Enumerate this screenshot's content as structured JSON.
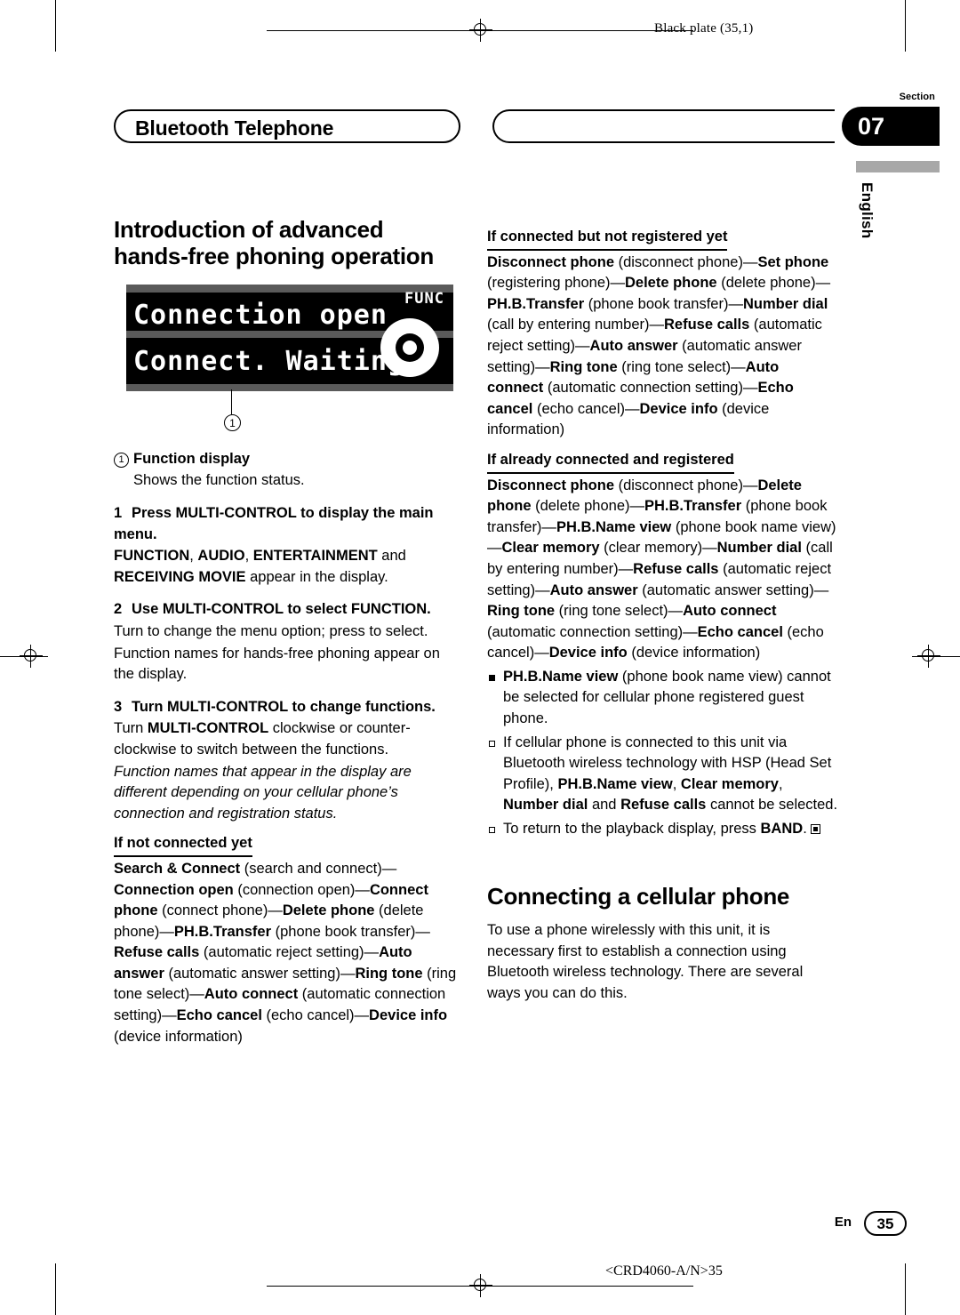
{
  "page": {
    "black_plate": "Black plate (35,1)",
    "section_label": "Section",
    "section_number": "07",
    "language_tab": "English",
    "running_head": "Bluetooth Telephone",
    "footer_en": "En",
    "footer_page": "35",
    "footer_code": "<CRD4060-A/N>35"
  },
  "lcd": {
    "line1": "Connection open",
    "line2": "Connect. Waiting",
    "fn_label": "FUNC",
    "callout": "1"
  },
  "left_column": {
    "heading": "Introduction of advanced hands-free phoning operation",
    "callout_item": {
      "num": "1",
      "title": "Function display",
      "desc": "Shows the function status."
    },
    "step1": {
      "num": "1",
      "title": "Press MULTI-CONTROL to display the main menu.",
      "body_bold_1": "FUNCTION",
      "body_sep_1": ", ",
      "body_bold_2": "AUDIO",
      "body_sep_2": ", ",
      "body_bold_3": "ENTERTAINMENT",
      "body_mid": " and ",
      "body_bold_4": "RECEIVING MOVIE",
      "body_tail": " appear in the display."
    },
    "step2": {
      "num": "2",
      "title": "Use MULTI-CONTROL to select FUNCTION.",
      "p1": "Turn to change the menu option; press to select.",
      "p2": "Function names for hands-free phoning appear on the display."
    },
    "step3": {
      "num": "3",
      "title": "Turn MULTI-CONTROL to change functions.",
      "p1_a": "Turn ",
      "p1_b": "MULTI-CONTROL",
      "p1_c": " clockwise or counter-clockwise to switch between the functions.",
      "p2": "Function names that appear in the display are different depending on your cellular phone’s connection and registration status."
    },
    "not_connected_heading": "If not connected yet",
    "not_connected_chain": [
      {
        "t": "Search & Connect",
        "s": "b"
      },
      {
        "t": " (search and connect)—",
        "s": "n"
      },
      {
        "t": "Connection open",
        "s": "b"
      },
      {
        "t": " (connection open)—",
        "s": "n"
      },
      {
        "t": "Connect phone",
        "s": "b"
      },
      {
        "t": " (connect phone)—",
        "s": "n"
      },
      {
        "t": "Delete phone",
        "s": "b"
      },
      {
        "t": " (delete phone)—",
        "s": "n"
      },
      {
        "t": "PH.B.Transfer",
        "s": "b"
      },
      {
        "t": " (phone book transfer)—",
        "s": "n"
      },
      {
        "t": "Refuse calls",
        "s": "b"
      },
      {
        "t": " (automatic reject setting)—",
        "s": "n"
      },
      {
        "t": "Auto answer",
        "s": "b"
      },
      {
        "t": " (automatic answer setting)—",
        "s": "n"
      },
      {
        "t": "Ring tone",
        "s": "b"
      },
      {
        "t": " (ring tone select)—",
        "s": "n"
      },
      {
        "t": "Auto connect",
        "s": "b"
      },
      {
        "t": " (automatic connection setting)—",
        "s": "n"
      },
      {
        "t": "Echo cancel",
        "s": "b"
      },
      {
        "t": " (echo cancel)—",
        "s": "n"
      },
      {
        "t": "Device info",
        "s": "b"
      },
      {
        "t": " (device information)",
        "s": "n"
      }
    ]
  },
  "right_column": {
    "connected_not_registered_heading": "If connected but not registered yet",
    "connected_not_registered_chain": [
      {
        "t": "Disconnect phone",
        "s": "b"
      },
      {
        "t": " (disconnect phone)—",
        "s": "n"
      },
      {
        "t": "Set phone",
        "s": "b"
      },
      {
        "t": " (registering phone)—",
        "s": "n"
      },
      {
        "t": "Delete phone",
        "s": "b"
      },
      {
        "t": " (delete phone)—",
        "s": "n"
      },
      {
        "t": "PH.B.Transfer",
        "s": "b"
      },
      {
        "t": " (phone book transfer)—",
        "s": "n"
      },
      {
        "t": "Number dial",
        "s": "b"
      },
      {
        "t": " (call by entering number)—",
        "s": "n"
      },
      {
        "t": "Refuse calls",
        "s": "b"
      },
      {
        "t": " (automatic reject setting)—",
        "s": "n"
      },
      {
        "t": "Auto answer",
        "s": "b"
      },
      {
        "t": " (automatic answer setting)—",
        "s": "n"
      },
      {
        "t": "Ring tone",
        "s": "b"
      },
      {
        "t": " (ring tone select)—",
        "s": "n"
      },
      {
        "t": "Auto connect",
        "s": "b"
      },
      {
        "t": " (automatic connection setting)—",
        "s": "n"
      },
      {
        "t": "Echo cancel",
        "s": "b"
      },
      {
        "t": " (echo cancel)—",
        "s": "n"
      },
      {
        "t": "Device info",
        "s": "b"
      },
      {
        "t": " (device information)",
        "s": "n"
      }
    ],
    "already_connected_heading": "If already connected and registered",
    "already_connected_chain": [
      {
        "t": "Disconnect phone",
        "s": "b"
      },
      {
        "t": " (disconnect phone)—",
        "s": "n"
      },
      {
        "t": "Delete phone",
        "s": "b"
      },
      {
        "t": " (delete phone)—",
        "s": "n"
      },
      {
        "t": "PH.B.Transfer",
        "s": "b"
      },
      {
        "t": " (phone book transfer)—",
        "s": "n"
      },
      {
        "t": "PH.B.Name view",
        "s": "b"
      },
      {
        "t": " (phone book name view)—",
        "s": "n"
      },
      {
        "t": "Clear memory",
        "s": "b"
      },
      {
        "t": " (clear memory)—",
        "s": "n"
      },
      {
        "t": "Number dial",
        "s": "b"
      },
      {
        "t": " (call by entering number)—",
        "s": "n"
      },
      {
        "t": "Refuse calls",
        "s": "b"
      },
      {
        "t": " (automatic reject setting)—",
        "s": "n"
      },
      {
        "t": "Auto answer",
        "s": "b"
      },
      {
        "t": " (automatic answer setting)—",
        "s": "n"
      },
      {
        "t": "Ring tone",
        "s": "b"
      },
      {
        "t": " (ring tone select)—",
        "s": "n"
      },
      {
        "t": "Auto connect",
        "s": "b"
      },
      {
        "t": " (automatic connection setting)—",
        "s": "n"
      },
      {
        "t": "Echo cancel",
        "s": "b"
      },
      {
        "t": " (echo cancel)—",
        "s": "n"
      },
      {
        "t": "Device info",
        "s": "b"
      },
      {
        "t": " (device information)",
        "s": "n"
      }
    ],
    "note1": [
      {
        "t": "PH.B.Name view",
        "s": "b"
      },
      {
        "t": " (phone book name view) cannot be selected for cellular phone registered guest phone.",
        "s": "n"
      }
    ],
    "note2": [
      {
        "t": "If cellular phone is connected to this unit via Bluetooth wireless technology with HSP (Head Set Profile), ",
        "s": "n"
      },
      {
        "t": "PH.B.Name view",
        "s": "b"
      },
      {
        "t": ", ",
        "s": "n"
      },
      {
        "t": "Clear memory",
        "s": "b"
      },
      {
        "t": ", ",
        "s": "n"
      },
      {
        "t": "Number dial",
        "s": "b"
      },
      {
        "t": " and ",
        "s": "n"
      },
      {
        "t": "Refuse calls",
        "s": "b"
      },
      {
        "t": " cannot be selected.",
        "s": "n"
      }
    ],
    "note3": [
      {
        "t": "To return to the playback display, press ",
        "s": "n"
      },
      {
        "t": "BAND",
        "s": "b"
      },
      {
        "t": ".",
        "s": "n"
      }
    ],
    "section2_heading": "Connecting a cellular phone",
    "section2_body": "To use a phone wirelessly with this unit, it is necessary first to establish a connection using Bluetooth wireless technology. There are several ways you can do this."
  }
}
